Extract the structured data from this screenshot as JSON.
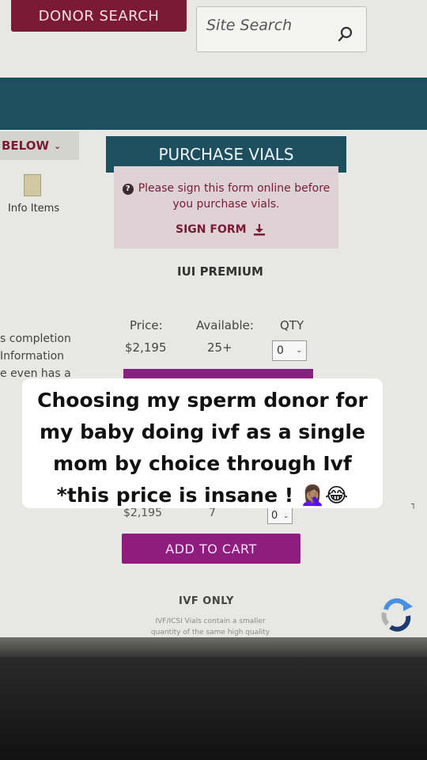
{
  "header": {
    "donor_search_label": "DONOR SEARCH",
    "site_search_placeholder": "Site Search"
  },
  "sidebar": {
    "below_label": "BELOW",
    "info_items_label": "Info Items",
    "text_lines": [
      "s completion",
      "Information",
      "e even has a"
    ]
  },
  "purchase": {
    "title": "PURCHASE VIALS",
    "notice_line1": "Please sign this form online before",
    "notice_line2": "you purchase vials.",
    "sign_form_label": "SIGN FORM"
  },
  "iui_premium": {
    "title": "IUI PREMIUM",
    "price_header": "Price:",
    "available_header": "Available:",
    "qty_header": "QTY",
    "price": "$2,195",
    "available": "25+",
    "qty": "0"
  },
  "second_product": {
    "price": "$2,195",
    "available": "7",
    "qty": "0",
    "add_to_cart_label": "ADD TO CART"
  },
  "ivf_only": {
    "title": "IVF ONLY",
    "desc_line1": "IVF/ICSI Vials contain a smaller",
    "desc_line2": "quantity of the same high quality"
  },
  "caption": {
    "line1": "Choosing my sperm donor for",
    "line2": "my baby doing ivf as a single",
    "line3": "mom by choice through Ivf",
    "line4": "*this price is insane ! 🤦🏽‍♀️😂"
  },
  "colors": {
    "brand_maroon": "#7a1a35",
    "teal": "#1d4f5f",
    "cart_purple": "#8e1d80"
  }
}
